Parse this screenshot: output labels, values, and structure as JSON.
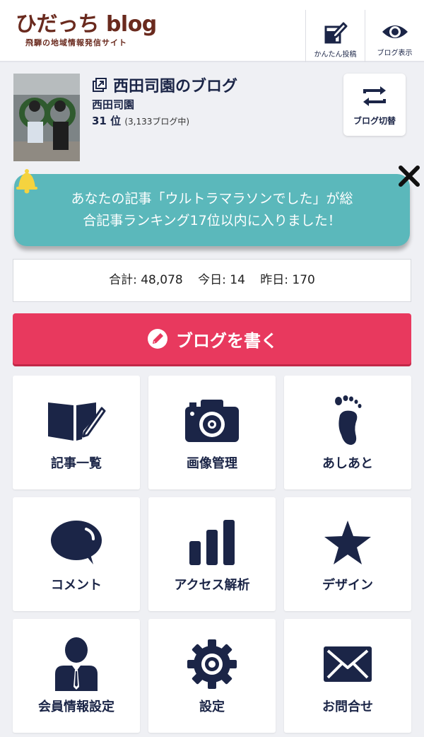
{
  "header": {
    "logo_title": "ひだっち blog",
    "logo_subtitle": "飛騨の地域情報発信サイト",
    "quick_post_label": "かんたん投稿",
    "view_blog_label": "ブログ表示"
  },
  "profile": {
    "blog_title": "西田司園のブログ",
    "owner_name": "西田司園",
    "rank": "31 位",
    "rank_note": "(3,133ブログ中)",
    "switch_label": "ブログ切替"
  },
  "notification": {
    "line1": "あなたの記事「ウルトラマラソンでした」が総",
    "line2": "合記事ランキング17位以内に入りました！"
  },
  "counter": {
    "total": "合計: 48,078",
    "today": "今日: 14",
    "yesterday": "昨日: 170"
  },
  "write_button": {
    "label": "ブログを書く"
  },
  "menu": [
    {
      "label": "記事一覧",
      "icon": "book-pen-icon"
    },
    {
      "label": "画像管理",
      "icon": "camera-icon"
    },
    {
      "label": "あしあと",
      "icon": "footprint-icon"
    },
    {
      "label": "コメント",
      "icon": "speech-bubble-icon"
    },
    {
      "label": "アクセス解析",
      "icon": "bar-chart-icon"
    },
    {
      "label": "デザイン",
      "icon": "star-icon"
    },
    {
      "label": "会員情報設定",
      "icon": "user-icon"
    },
    {
      "label": "設定",
      "icon": "gear-icon"
    },
    {
      "label": "お問合せ",
      "icon": "mail-icon"
    }
  ],
  "colors": {
    "navy": "#1b2547",
    "accent_red": "#e8395e",
    "notify_teal": "#5bb8bb",
    "logo_brown": "#6a2a1e"
  }
}
